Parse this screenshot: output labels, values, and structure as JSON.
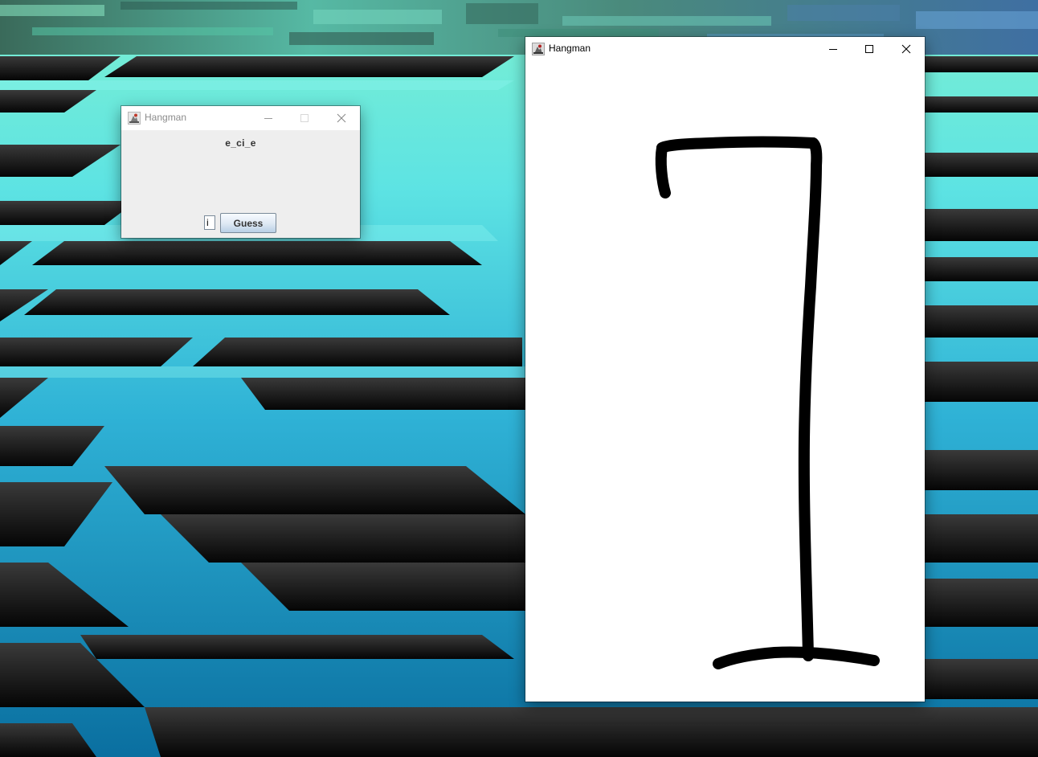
{
  "desktop": {
    "wallpaper": "abstract teal maze perspective"
  },
  "small_window": {
    "title": "Hangman",
    "state": "inactive",
    "word_display": "e_ci_e",
    "input_value": "i",
    "guess_button_label": "Guess",
    "caption_buttons": [
      "minimize-icon",
      "maximize-icon",
      "close-icon"
    ]
  },
  "big_window": {
    "title": "Hangman",
    "state": "active",
    "caption_buttons": [
      "minimize-icon",
      "maximize-icon",
      "close-icon"
    ],
    "drawing": {
      "parts_shown": [
        "base",
        "pole",
        "beam",
        "rope"
      ],
      "stroke_color": "#000000"
    }
  },
  "colors": {
    "window_bg": "#ffffff",
    "client_bg": "#eeeeee",
    "text": "#333333",
    "inactive_title": "#8c8c8c",
    "wallpaper_teal": "#4fd3d8",
    "wallpaper_dark": "#0f0f0f"
  }
}
